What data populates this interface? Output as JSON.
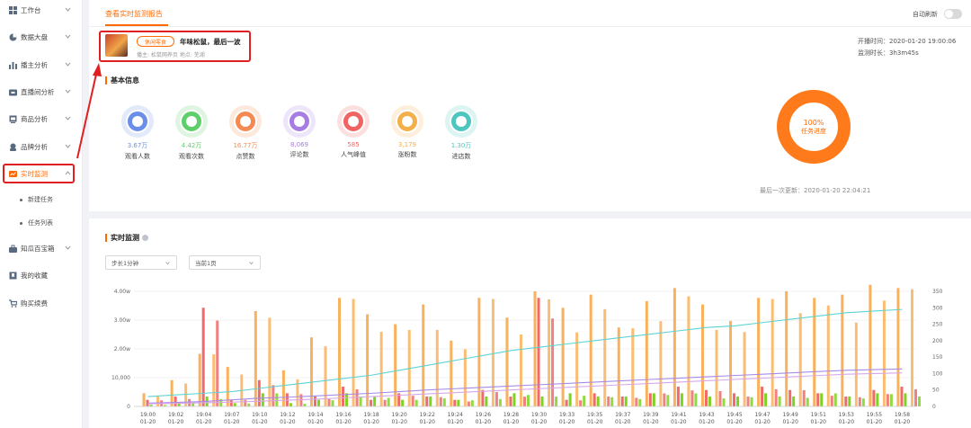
{
  "sidebar": {
    "items": [
      {
        "label": "工作台",
        "icon": "grid-icon",
        "has_chevron": true
      },
      {
        "label": "数据大盘",
        "icon": "pie-chart-icon",
        "has_chevron": true
      },
      {
        "label": "播主分析",
        "icon": "bar-chart-icon",
        "has_chevron": true
      },
      {
        "label": "直播间分析",
        "icon": "tv-icon",
        "has_chevron": true
      },
      {
        "label": "商品分析",
        "icon": "product-icon",
        "has_chevron": true
      },
      {
        "label": "品牌分析",
        "icon": "brand-icon",
        "has_chevron": true
      },
      {
        "label": "实时监测",
        "icon": "monitor-icon",
        "has_chevron": true,
        "active": true
      },
      {
        "label": "知瓜百宝箱",
        "icon": "toolbox-icon",
        "has_chevron": true
      },
      {
        "label": "我的收藏",
        "icon": "bookmark-icon",
        "has_chevron": false
      },
      {
        "label": "购买续费",
        "icon": "cart-icon",
        "has_chevron": false
      }
    ],
    "sub_items": [
      "新建任务",
      "任务列表"
    ]
  },
  "header": {
    "tab_label": "查看实时监测报告",
    "auto_refresh_label": "自动刷新",
    "auto_refresh_on": false
  },
  "room": {
    "tag": "休闲零食",
    "title": "年味松鼠，最后一波",
    "meta": "播主: 松鼠网养页  地点: 芜湖",
    "start_time": "开播时间：2020-01-20 19:00:06",
    "duration": "监测时长：3h3m45s"
  },
  "basic_info": {
    "title": "基本信息",
    "stats": [
      {
        "value": "3.67万",
        "label": "观看人数",
        "color": "#6b8fe8",
        "icon": "person-icon"
      },
      {
        "value": "4.42万",
        "label": "观看次数",
        "color": "#5fcf6a",
        "icon": "grid-dots-icon"
      },
      {
        "value": "16.77万",
        "label": "点赞数",
        "color": "#f48a52",
        "icon": "thumb-up-icon"
      },
      {
        "value": "8,069",
        "label": "评论数",
        "color": "#a77de3",
        "icon": "comment-icon"
      },
      {
        "value": "585",
        "label": "人气峰值",
        "color": "#f06464",
        "icon": "fire-icon"
      },
      {
        "value": "3,179",
        "label": "涨粉数",
        "color": "#f3b04a",
        "icon": "heart-icon"
      },
      {
        "value": "1.30万",
        "label": "进店数",
        "color": "#4ec6c0",
        "icon": "store-icon"
      }
    ],
    "progress_percent": "100%",
    "progress_label": "任务进度",
    "progress_value": 1.0,
    "last_update": "最后一次更新：2020-01-20 22:04:21"
  },
  "monitor": {
    "title": "实时监测",
    "step_select": "步长1分钟",
    "page_select": "当前1页"
  },
  "chart_data": {
    "type": "bar",
    "left_ticks": [
      "0",
      "10,000",
      "2.00w",
      "3.00w",
      "4.00w"
    ],
    "right_ticks": [
      "0",
      "50",
      "100",
      "150",
      "200",
      "250",
      "300",
      "350"
    ],
    "left_ylim": [
      0,
      40000
    ],
    "right_ylim": [
      0,
      350
    ],
    "x_ticks": [
      {
        "time": "19:00",
        "date": "01-20"
      },
      {
        "time": "19:02",
        "date": "01-20"
      },
      {
        "time": "19:04",
        "date": "01-20"
      },
      {
        "time": "19:07",
        "date": "01-20"
      },
      {
        "time": "19:10",
        "date": "01-20"
      },
      {
        "time": "19:12",
        "date": "01-20"
      },
      {
        "time": "19:14",
        "date": "01-20"
      },
      {
        "time": "19:16",
        "date": "01-20"
      },
      {
        "time": "19:18",
        "date": "01-20"
      },
      {
        "time": "19:20",
        "date": "01-20"
      },
      {
        "time": "19:22",
        "date": "01-20"
      },
      {
        "time": "19:24",
        "date": "01-20"
      },
      {
        "time": "19:26",
        "date": "01-20"
      },
      {
        "time": "19:28",
        "date": "01-20"
      },
      {
        "time": "19:30",
        "date": "01-20"
      },
      {
        "time": "19:33",
        "date": "01-20"
      },
      {
        "time": "19:35",
        "date": "01-20"
      },
      {
        "time": "19:37",
        "date": "01-20"
      },
      {
        "time": "19:39",
        "date": "01-20"
      },
      {
        "time": "19:41",
        "date": "01-20"
      },
      {
        "time": "19:43",
        "date": "01-20"
      },
      {
        "time": "19:45",
        "date": "01-20"
      },
      {
        "time": "19:47",
        "date": "01-20"
      },
      {
        "time": "19:49",
        "date": "01-20"
      },
      {
        "time": "19:51",
        "date": "01-20"
      },
      {
        "time": "19:53",
        "date": "01-20"
      },
      {
        "time": "19:55",
        "date": "01-20"
      },
      {
        "time": "19:58",
        "date": "01-20"
      }
    ],
    "series": [
      {
        "color": "#f9b15c",
        "values": [
          40,
          80,
          160,
          120,
          290,
          110,
          210,
          330,
          280,
          250,
          310,
          200,
          330,
          270,
          350,
          300,
          340,
          240,
          320,
          360,
          310,
          260,
          330,
          350,
          330,
          340,
          370,
          360
        ]
      },
      {
        "color": "#ef6a6a",
        "values": [
          20,
          30,
          300,
          20,
          80,
          40,
          30,
          60,
          20,
          40,
          30,
          20,
          50,
          30,
          330,
          20,
          40,
          30,
          40,
          60,
          50,
          40,
          60,
          50,
          40,
          30,
          50,
          60
        ]
      },
      {
        "color": "#7ed321",
        "values": [
          5,
          10,
          30,
          10,
          40,
          10,
          20,
          40,
          30,
          20,
          30,
          20,
          30,
          40,
          30,
          40,
          30,
          30,
          40,
          40,
          30,
          30,
          40,
          30,
          40,
          30,
          40,
          40
        ]
      },
      {
        "color": "#5fd3d3",
        "values": [
          30,
          35,
          40,
          45,
          55,
          65,
          75,
          85,
          95,
          110,
          125,
          140,
          155,
          170,
          180,
          190,
          200,
          210,
          220,
          230,
          240,
          245,
          255,
          265,
          275,
          285,
          290,
          295
        ]
      },
      {
        "color": "#a88be8",
        "values": [
          10,
          12,
          15,
          20,
          25,
          28,
          32,
          36,
          40,
          45,
          50,
          54,
          58,
          62,
          66,
          70,
          74,
          78,
          82,
          86,
          90,
          94,
          98,
          102,
          106,
          110,
          112,
          114
        ]
      },
      {
        "color": "#d9a7e8",
        "values": [
          8,
          9,
          11,
          13,
          16,
          19,
          22,
          26,
          30,
          34,
          38,
          42,
          46,
          50,
          54,
          58,
          62,
          66,
          70,
          74,
          78,
          82,
          86,
          90,
          94,
          98,
          100,
          102
        ]
      }
    ]
  }
}
